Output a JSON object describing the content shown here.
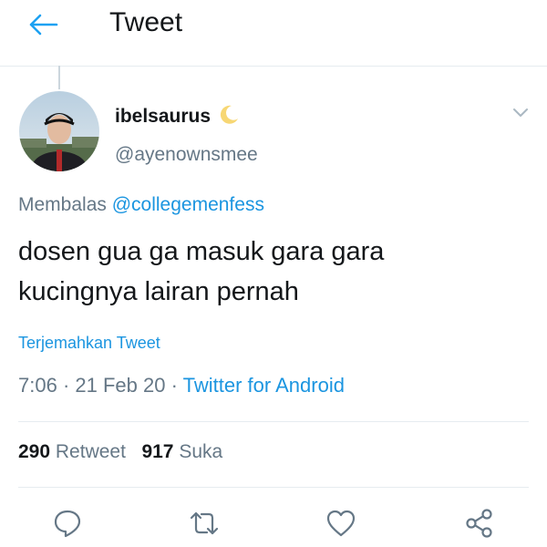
{
  "header": {
    "title": "Tweet",
    "back_icon": "arrow-left-icon",
    "accent": "#1da1f2"
  },
  "tweet": {
    "display_name": "ibelsaurus",
    "name_emoji": "crescent-moon-icon",
    "handle": "@ayenownsmee",
    "reply_prefix": "Membalas",
    "reply_to": "@collegemenfess",
    "text_line1": "dosen gua ga masuk gara gara",
    "text_line2": "kucingnya lairan pernah",
    "translate": "Terjemahkan Tweet",
    "time": "7:06",
    "date": "21 Feb 20",
    "source": "Twitter for Android",
    "dot": "·"
  },
  "stats": {
    "retweets_count": "290",
    "retweets_label": "Retweet",
    "likes_count": "917",
    "likes_label": "Suka"
  },
  "actions": [
    "reply-icon",
    "retweet-icon",
    "like-icon",
    "share-icon"
  ],
  "colors": {
    "link": "#1b95e0",
    "secondary": "#657786",
    "text": "#14171a",
    "divider": "#e6ecf0"
  }
}
